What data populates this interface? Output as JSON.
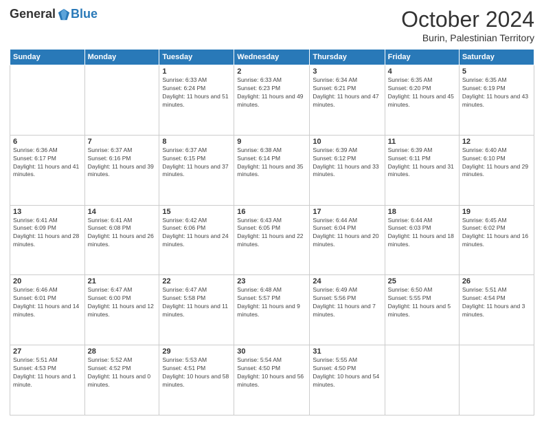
{
  "header": {
    "logo_general": "General",
    "logo_blue": "Blue",
    "month_title": "October 2024",
    "subtitle": "Burin, Palestinian Territory"
  },
  "days_of_week": [
    "Sunday",
    "Monday",
    "Tuesday",
    "Wednesday",
    "Thursday",
    "Friday",
    "Saturday"
  ],
  "weeks": [
    [
      {
        "day": "",
        "info": ""
      },
      {
        "day": "",
        "info": ""
      },
      {
        "day": "1",
        "info": "Sunrise: 6:33 AM\nSunset: 6:24 PM\nDaylight: 11 hours and 51 minutes."
      },
      {
        "day": "2",
        "info": "Sunrise: 6:33 AM\nSunset: 6:23 PM\nDaylight: 11 hours and 49 minutes."
      },
      {
        "day": "3",
        "info": "Sunrise: 6:34 AM\nSunset: 6:21 PM\nDaylight: 11 hours and 47 minutes."
      },
      {
        "day": "4",
        "info": "Sunrise: 6:35 AM\nSunset: 6:20 PM\nDaylight: 11 hours and 45 minutes."
      },
      {
        "day": "5",
        "info": "Sunrise: 6:35 AM\nSunset: 6:19 PM\nDaylight: 11 hours and 43 minutes."
      }
    ],
    [
      {
        "day": "6",
        "info": "Sunrise: 6:36 AM\nSunset: 6:17 PM\nDaylight: 11 hours and 41 minutes."
      },
      {
        "day": "7",
        "info": "Sunrise: 6:37 AM\nSunset: 6:16 PM\nDaylight: 11 hours and 39 minutes."
      },
      {
        "day": "8",
        "info": "Sunrise: 6:37 AM\nSunset: 6:15 PM\nDaylight: 11 hours and 37 minutes."
      },
      {
        "day": "9",
        "info": "Sunrise: 6:38 AM\nSunset: 6:14 PM\nDaylight: 11 hours and 35 minutes."
      },
      {
        "day": "10",
        "info": "Sunrise: 6:39 AM\nSunset: 6:12 PM\nDaylight: 11 hours and 33 minutes."
      },
      {
        "day": "11",
        "info": "Sunrise: 6:39 AM\nSunset: 6:11 PM\nDaylight: 11 hours and 31 minutes."
      },
      {
        "day": "12",
        "info": "Sunrise: 6:40 AM\nSunset: 6:10 PM\nDaylight: 11 hours and 29 minutes."
      }
    ],
    [
      {
        "day": "13",
        "info": "Sunrise: 6:41 AM\nSunset: 6:09 PM\nDaylight: 11 hours and 28 minutes."
      },
      {
        "day": "14",
        "info": "Sunrise: 6:41 AM\nSunset: 6:08 PM\nDaylight: 11 hours and 26 minutes."
      },
      {
        "day": "15",
        "info": "Sunrise: 6:42 AM\nSunset: 6:06 PM\nDaylight: 11 hours and 24 minutes."
      },
      {
        "day": "16",
        "info": "Sunrise: 6:43 AM\nSunset: 6:05 PM\nDaylight: 11 hours and 22 minutes."
      },
      {
        "day": "17",
        "info": "Sunrise: 6:44 AM\nSunset: 6:04 PM\nDaylight: 11 hours and 20 minutes."
      },
      {
        "day": "18",
        "info": "Sunrise: 6:44 AM\nSunset: 6:03 PM\nDaylight: 11 hours and 18 minutes."
      },
      {
        "day": "19",
        "info": "Sunrise: 6:45 AM\nSunset: 6:02 PM\nDaylight: 11 hours and 16 minutes."
      }
    ],
    [
      {
        "day": "20",
        "info": "Sunrise: 6:46 AM\nSunset: 6:01 PM\nDaylight: 11 hours and 14 minutes."
      },
      {
        "day": "21",
        "info": "Sunrise: 6:47 AM\nSunset: 6:00 PM\nDaylight: 11 hours and 12 minutes."
      },
      {
        "day": "22",
        "info": "Sunrise: 6:47 AM\nSunset: 5:58 PM\nDaylight: 11 hours and 11 minutes."
      },
      {
        "day": "23",
        "info": "Sunrise: 6:48 AM\nSunset: 5:57 PM\nDaylight: 11 hours and 9 minutes."
      },
      {
        "day": "24",
        "info": "Sunrise: 6:49 AM\nSunset: 5:56 PM\nDaylight: 11 hours and 7 minutes."
      },
      {
        "day": "25",
        "info": "Sunrise: 6:50 AM\nSunset: 5:55 PM\nDaylight: 11 hours and 5 minutes."
      },
      {
        "day": "26",
        "info": "Sunrise: 5:51 AM\nSunset: 4:54 PM\nDaylight: 11 hours and 3 minutes."
      }
    ],
    [
      {
        "day": "27",
        "info": "Sunrise: 5:51 AM\nSunset: 4:53 PM\nDaylight: 11 hours and 1 minute."
      },
      {
        "day": "28",
        "info": "Sunrise: 5:52 AM\nSunset: 4:52 PM\nDaylight: 11 hours and 0 minutes."
      },
      {
        "day": "29",
        "info": "Sunrise: 5:53 AM\nSunset: 4:51 PM\nDaylight: 10 hours and 58 minutes."
      },
      {
        "day": "30",
        "info": "Sunrise: 5:54 AM\nSunset: 4:50 PM\nDaylight: 10 hours and 56 minutes."
      },
      {
        "day": "31",
        "info": "Sunrise: 5:55 AM\nSunset: 4:50 PM\nDaylight: 10 hours and 54 minutes."
      },
      {
        "day": "",
        "info": ""
      },
      {
        "day": "",
        "info": ""
      }
    ]
  ]
}
